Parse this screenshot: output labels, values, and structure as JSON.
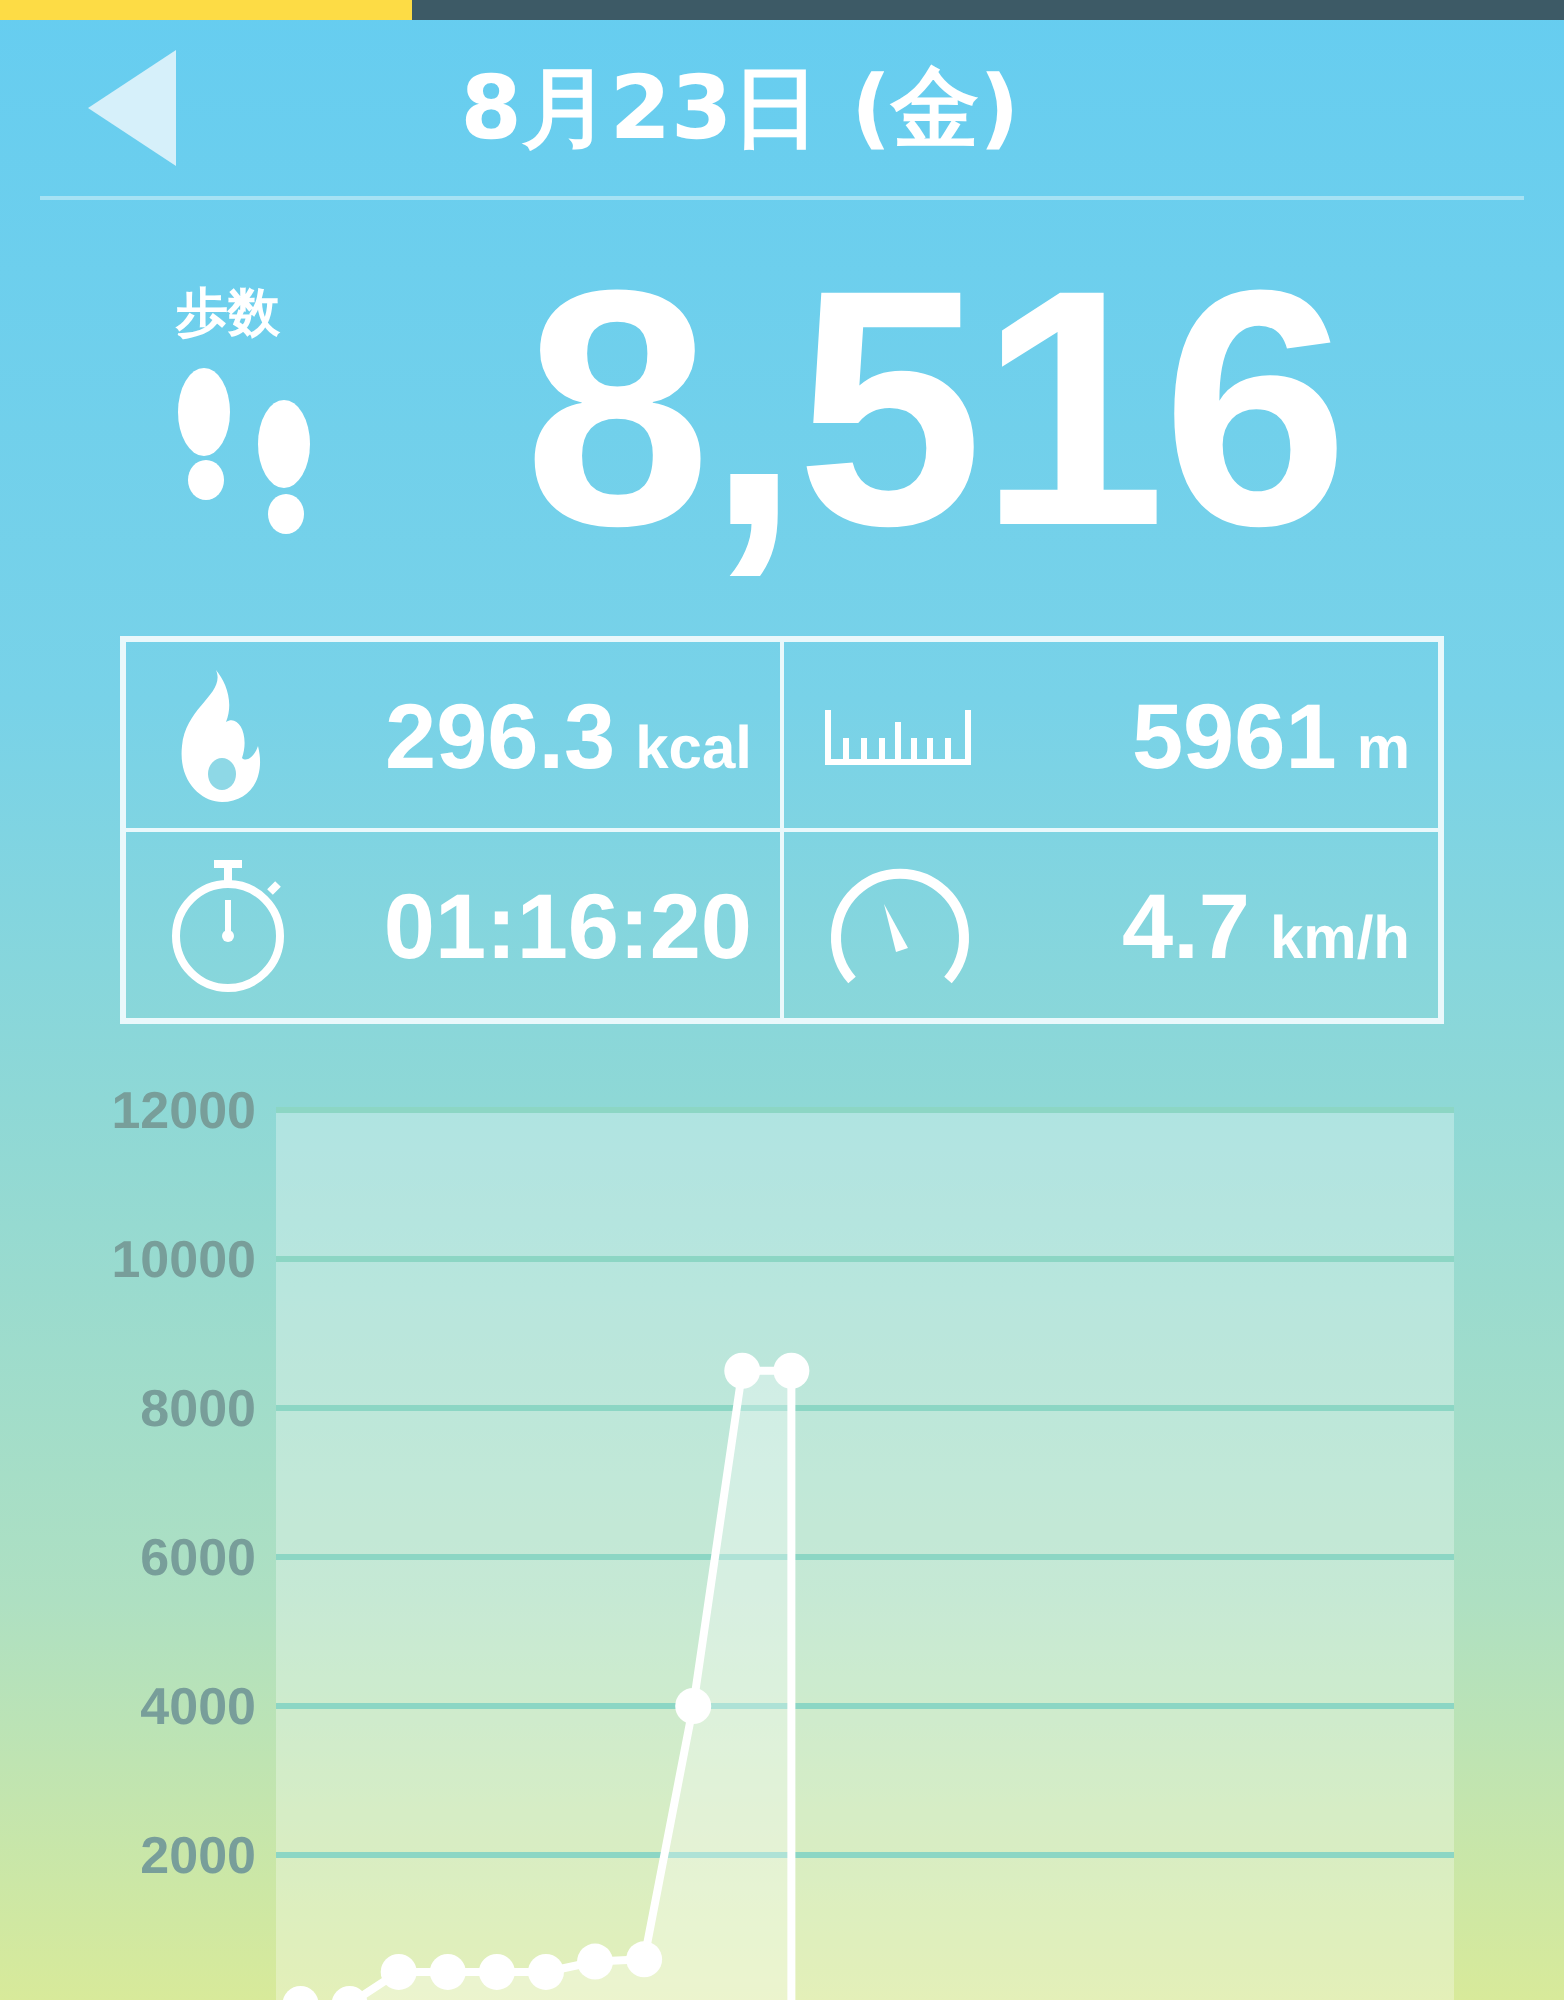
{
  "top_indicator": {
    "level": 0.263
  },
  "header": {
    "title": "8月23日 (金)"
  },
  "steps": {
    "label": "歩数",
    "value": "8,516"
  },
  "stats": [
    {
      "kind": "calories",
      "value": "296.3",
      "unit": "kcal"
    },
    {
      "kind": "distance",
      "value": "5961",
      "unit": "m"
    },
    {
      "kind": "time",
      "value": "01:16:20"
    },
    {
      "kind": "speed",
      "value": "4.7",
      "unit": "km/h"
    }
  ],
  "chart": {
    "chart_data": {
      "type": "area",
      "categories": [
        null,
        null,
        null,
        null,
        null,
        null,
        null,
        null,
        null,
        null,
        null,
        null,
        null,
        null,
        null,
        null,
        null,
        null,
        null,
        null,
        null,
        null,
        null,
        null
      ],
      "series": [
        {
          "color": "#ffffff",
          "values": [
            0,
            0,
            430,
            430,
            430,
            430,
            570,
            600,
            4000,
            8500,
            8500,
            null,
            null,
            null,
            null,
            null,
            null,
            null,
            null,
            null,
            null,
            null,
            null,
            null
          ]
        }
      ],
      "grid": true,
      "ylim": [
        0,
        12000
      ],
      "yticks": [
        2000,
        4000,
        6000,
        8000,
        10000,
        12000
      ]
    }
  }
}
